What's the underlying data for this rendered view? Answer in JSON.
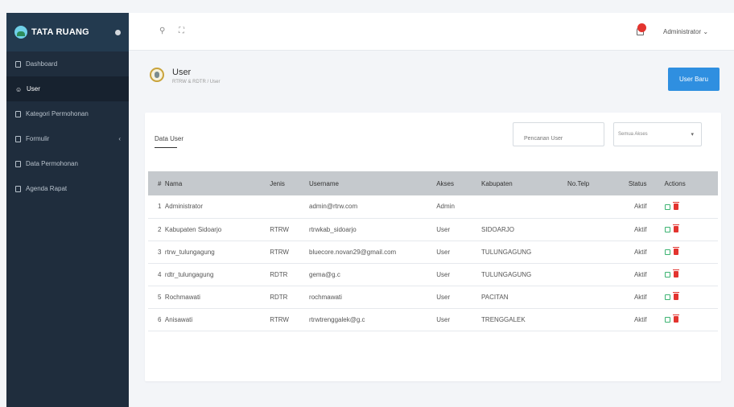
{
  "sidebar": {
    "brand": "TATA RUANG",
    "items": [
      {
        "label": "Dashboard",
        "active": false,
        "chevron": false
      },
      {
        "label": "User",
        "active": true,
        "chevron": false
      },
      {
        "label": "Kategori Permohonan",
        "active": false,
        "chevron": false
      },
      {
        "label": "Formulir",
        "active": false,
        "chevron": true
      },
      {
        "label": "Data Permohonan",
        "active": false,
        "chevron": false
      },
      {
        "label": "Agenda Rapat",
        "active": false,
        "chevron": false
      }
    ]
  },
  "topbar": {
    "search_icon": "search-icon",
    "expand_icon": "expand-icon",
    "user": "Administrator"
  },
  "page": {
    "title": "User",
    "breadcrumb": "RTRW & RDTR  /  User",
    "new_button": "User Baru"
  },
  "card": {
    "title": "Data User",
    "search_placeholder": "Pencarian User",
    "filter_value": "Semua Akses"
  },
  "table": {
    "headers": [
      "#",
      "Nama",
      "Jenis",
      "Username",
      "Akses",
      "Kabupaten",
      "No.Telp",
      "Status",
      "Actions"
    ],
    "rows": [
      {
        "no": "1",
        "name": "Administrator",
        "jenis": "",
        "username": "admin@rtrw.com",
        "akses": "Admin",
        "kab": "",
        "telp": "",
        "status": "Aktif"
      },
      {
        "no": "2",
        "name": "Kabupaten Sidoarjo",
        "jenis": "RTRW",
        "username": "rtrwkab_sidoarjo",
        "akses": "User",
        "kab": "SIDOARJO",
        "telp": "",
        "status": "Aktif"
      },
      {
        "no": "3",
        "name": "rtrw_tulungagung",
        "jenis": "RTRW",
        "username": "bluecore.novan29@gmail.com",
        "akses": "User",
        "kab": "TULUNGAGUNG",
        "telp": "",
        "status": "Aktif"
      },
      {
        "no": "4",
        "name": "rdtr_tulungagung",
        "jenis": "RDTR",
        "username": "gema@g.c",
        "akses": "User",
        "kab": "TULUNGAGUNG",
        "telp": "",
        "status": "Aktif"
      },
      {
        "no": "5",
        "name": "Rochmawati",
        "jenis": "RDTR",
        "username": "rochmawati",
        "akses": "User",
        "kab": "PACITAN",
        "telp": "",
        "status": "Aktif"
      },
      {
        "no": "6",
        "name": "Anisawati",
        "jenis": "RTRW",
        "username": "rtrwtrenggalek@g.c",
        "akses": "User",
        "kab": "TRENGGALEK",
        "telp": "",
        "status": "Aktif"
      }
    ]
  }
}
